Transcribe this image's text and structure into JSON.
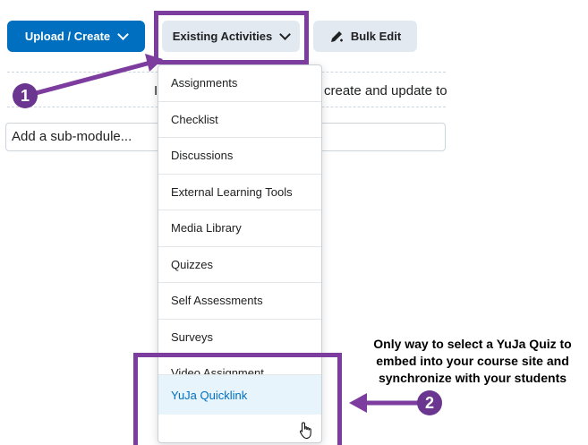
{
  "toolbar": {
    "upload_create_label": "Upload / Create",
    "existing_activities_label": "Existing Activities",
    "bulk_edit_label": "Bulk Edit"
  },
  "module": {
    "partial_text_left": "I",
    "partial_text_right": "create and update to",
    "submodule_placeholder": "Add a sub-module..."
  },
  "dropdown": {
    "items": [
      {
        "label": "Assignments"
      },
      {
        "label": "Checklist"
      },
      {
        "label": "Discussions"
      },
      {
        "label": "External Learning Tools"
      },
      {
        "label": "Media Library"
      },
      {
        "label": "Quizzes"
      },
      {
        "label": "Self Assessments"
      },
      {
        "label": "Surveys"
      },
      {
        "label": "Video Assignment"
      },
      {
        "label": "YuJa Quicklink"
      }
    ],
    "selected_index": 9
  },
  "callouts": {
    "step1": "1",
    "step2": "2"
  },
  "annotation": {
    "text": "Only way to select a YuJa Quiz to embed into your course site and synchronize with your students"
  },
  "colors": {
    "primary_blue": "#006fbf",
    "secondary_button_bg": "#e3e9f1",
    "highlight_purple": "#7d3d9e",
    "callout_purple": "#6b3690",
    "selected_item_bg": "#e7f4fb"
  },
  "icons": {
    "bulk_edit": "pencil-icon",
    "dropdown_chevron": "chevron-down-icon",
    "cursor": "hand-pointer-icon"
  }
}
